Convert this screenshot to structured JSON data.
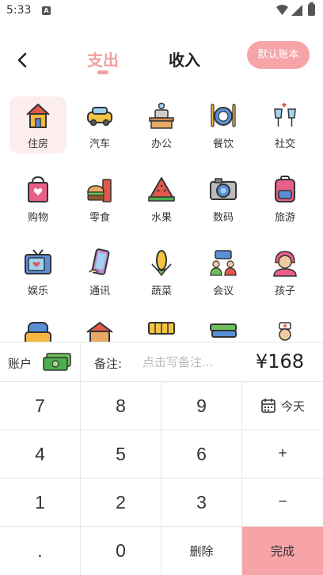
{
  "status_bar": {
    "time": "5:33",
    "notif_badge": "A"
  },
  "header": {
    "tabs": [
      {
        "label": "支出",
        "active": true
      },
      {
        "label": "收入",
        "active": false
      }
    ],
    "default_book_button": "默认账本"
  },
  "categories": [
    {
      "label": "住房",
      "icon": "house-icon",
      "selected": true
    },
    {
      "label": "汽车",
      "icon": "car-icon"
    },
    {
      "label": "办公",
      "icon": "office-desk-icon"
    },
    {
      "label": "餐饮",
      "icon": "dining-plate-icon"
    },
    {
      "label": "社交",
      "icon": "champagne-glasses-icon"
    },
    {
      "label": "购物",
      "icon": "shopping-bag-icon"
    },
    {
      "label": "零食",
      "icon": "burger-drink-icon"
    },
    {
      "label": "水果",
      "icon": "watermelon-icon"
    },
    {
      "label": "数码",
      "icon": "camera-icon"
    },
    {
      "label": "旅游",
      "icon": "backpack-icon"
    },
    {
      "label": "娱乐",
      "icon": "tv-icon"
    },
    {
      "label": "通讯",
      "icon": "phone-icon"
    },
    {
      "label": "蔬菜",
      "icon": "corn-icon"
    },
    {
      "label": "会议",
      "icon": "meeting-people-icon"
    },
    {
      "label": "孩子",
      "icon": "child-icon"
    }
  ],
  "partial_row_icons": [
    "sofa-icon",
    "home-store-icon",
    "shop-awning-icon",
    "books-icon",
    "nurse-icon"
  ],
  "bar": {
    "account_label": "账户",
    "account_icon": "cash-icon",
    "memo_label": "备注:",
    "memo_placeholder": "点击写备注...",
    "amount": "¥168"
  },
  "keypad": {
    "k7": "7",
    "k8": "8",
    "k9": "9",
    "today": "今天",
    "k4": "4",
    "k5": "5",
    "k6": "6",
    "plus": "+",
    "k1": "1",
    "k2": "2",
    "k3": "3",
    "minus": "−",
    "dot": ".",
    "k0": "0",
    "delete": "删除",
    "done": "完成"
  },
  "colors": {
    "accent": "#f6a4a8",
    "tab_active": "#f2a0a3",
    "selected_bg": "#fdeeee"
  }
}
